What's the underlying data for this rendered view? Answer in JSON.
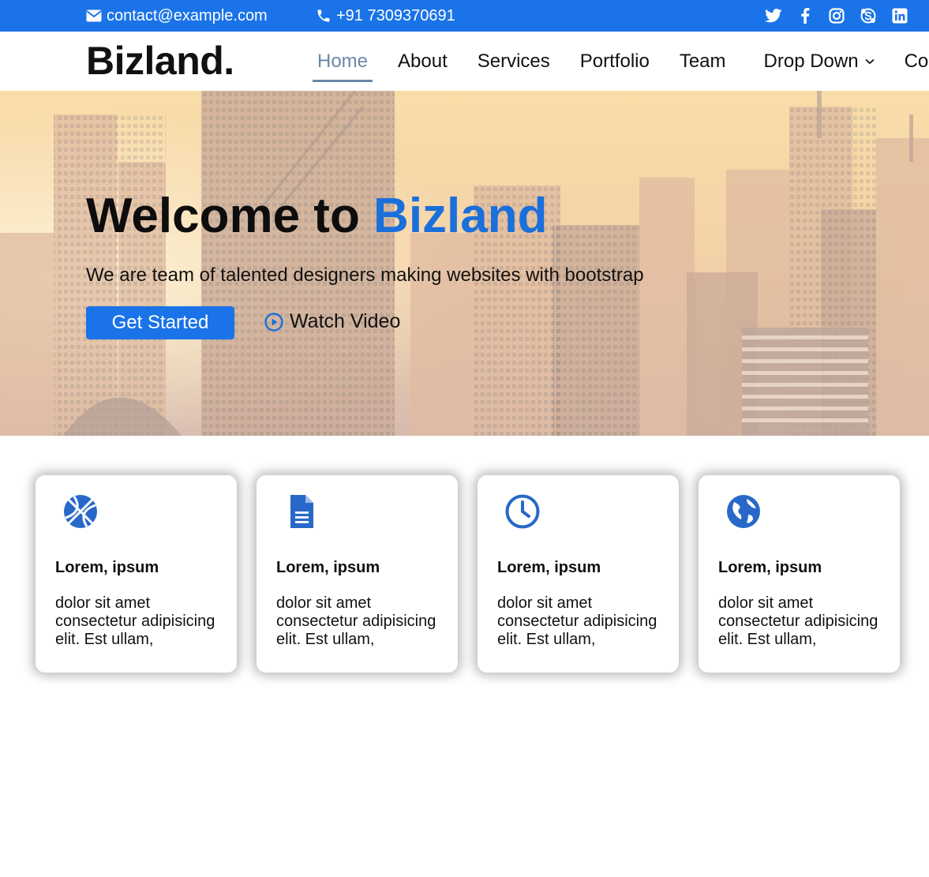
{
  "topbar": {
    "email": "contact@example.com",
    "phone": "+91 7309370691",
    "social": [
      "twitter-icon",
      "facebook-icon",
      "instagram-icon",
      "skype-icon",
      "linkedin-icon"
    ],
    "bg_color": "#1a73e8"
  },
  "header": {
    "logo": "Bizland.",
    "nav": [
      {
        "label": "Home",
        "active": true
      },
      {
        "label": "About"
      },
      {
        "label": "Services"
      },
      {
        "label": "Portfolio"
      },
      {
        "label": "Team"
      },
      {
        "label": "Drop Down"
      },
      {
        "label": "Contact"
      }
    ]
  },
  "hero": {
    "title_prefix": "Welcome to ",
    "title_accent": "Bizland",
    "subtitle": "We are team of talented designers making websites with bootstrap",
    "cta_label": "Get Started",
    "video_label": "Watch Video",
    "accent_color": "#1a6fdb"
  },
  "cards": [
    {
      "icon": "basketball-icon",
      "title": "Lorem, ipsum",
      "text": "dolor sit amet consectetur adipisicing elit. Est ullam,"
    },
    {
      "icon": "document-icon",
      "title": "Lorem, ipsum",
      "text": "dolor sit amet consectetur adipisicing elit. Est ullam,"
    },
    {
      "icon": "clock-icon",
      "title": "Lorem, ipsum",
      "text": "dolor sit amet consectetur adipisicing elit. Est ullam,"
    },
    {
      "icon": "globe-icon",
      "title": "Lorem, ipsum",
      "text": "dolor sit amet consectetur adipisicing elit. Est ullam,"
    }
  ]
}
